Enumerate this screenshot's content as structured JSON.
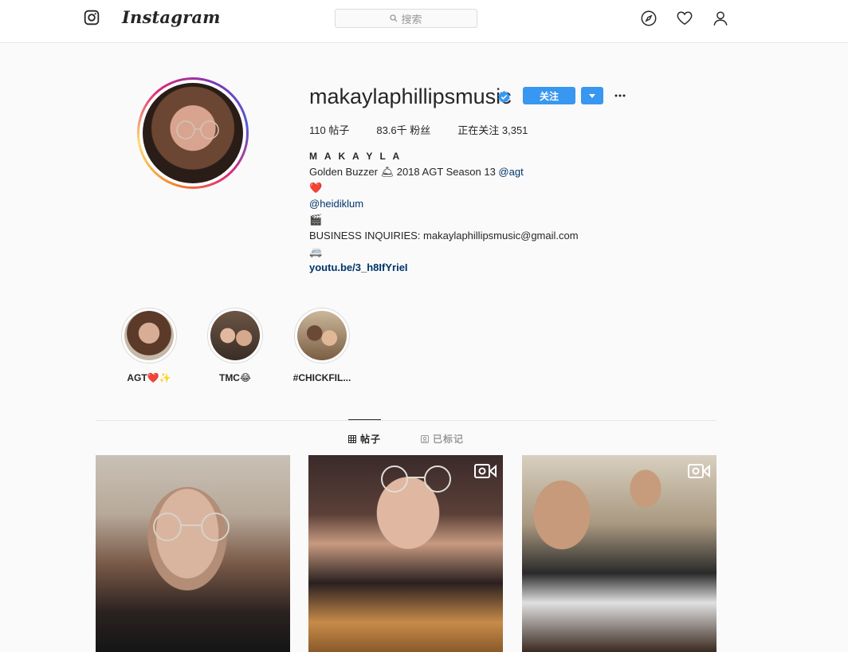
{
  "nav": {
    "brand": "Instagram",
    "search_placeholder": "搜索"
  },
  "profile": {
    "username": "makaylaphillipsmusic",
    "follow_label": "关注",
    "stats": {
      "posts": "110 帖子",
      "followers": "83.6千 粉丝",
      "following": "正在关注 3,351"
    },
    "bio": {
      "name": "M A K A Y L A",
      "line1_text": "Golden Buzzer 🛎 2018 AGT Season 13 ",
      "line1_mention": "@agt",
      "line2_emoji": "❤️",
      "line3_mention": "@heidiklum",
      "line4_emoji": "🎬",
      "line5_text": "BUSINESS INQUIRIES: makaylaphillipsmusic@gmail.com",
      "line6_emoji": "🚐",
      "link": "youtu.be/3_h8IfYrieI"
    }
  },
  "highlights": [
    {
      "label": "AGT❤️✨"
    },
    {
      "label": "TMC😂"
    },
    {
      "label": "#CHICKFIL..."
    }
  ],
  "tabs": {
    "posts": "帖子",
    "tagged": "已标记"
  },
  "colors": {
    "accent": "#3897f0",
    "link": "#003569",
    "text": "#262626",
    "muted": "#999999"
  }
}
